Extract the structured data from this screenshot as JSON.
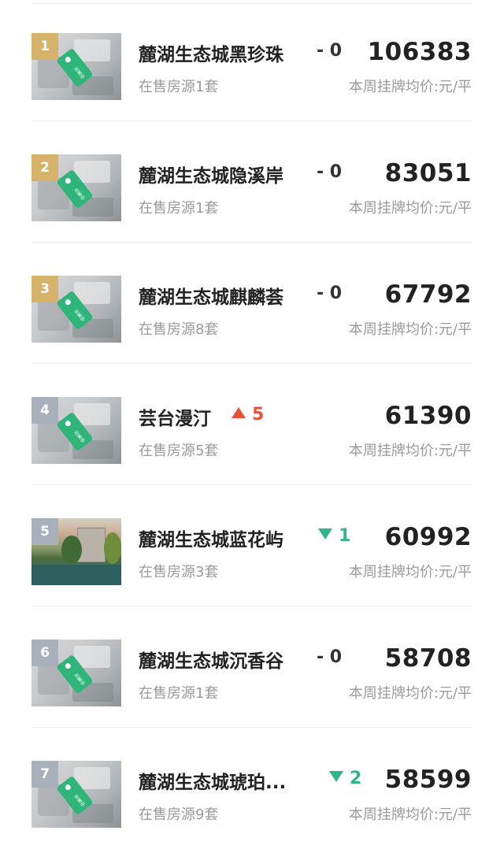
{
  "price_label": "本周挂牌均价:元/平",
  "tag_text": "在售中",
  "rows": [
    {
      "rank": "1",
      "name": "麓湖生态城黑珍珠",
      "change_text": "- 0",
      "direction": "flat",
      "price": "106383",
      "listing": "在售房源1套"
    },
    {
      "rank": "2",
      "name": "麓湖生态城隐溪岸",
      "change_text": "- 0",
      "direction": "flat",
      "price": "83051",
      "listing": "在售房源1套"
    },
    {
      "rank": "3",
      "name": "麓湖生态城麒麟荟",
      "change_text": "- 0",
      "direction": "flat",
      "price": "67792",
      "listing": "在售房源8套"
    },
    {
      "rank": "4",
      "name": "芸台漫汀",
      "change_text": "5",
      "direction": "up",
      "price": "61390",
      "listing": "在售房源5套"
    },
    {
      "rank": "5",
      "name": "麓湖生态城蓝花屿",
      "change_text": "1",
      "direction": "down",
      "price": "60992",
      "listing": "在售房源3套"
    },
    {
      "rank": "6",
      "name": "麓湖生态城沉香谷",
      "change_text": "- 0",
      "direction": "flat",
      "price": "58708",
      "listing": "在售房源1套"
    },
    {
      "rank": "7",
      "name": "麓湖生态城琥珀...",
      "change_text": "2",
      "direction": "down",
      "price": "58599",
      "listing": "在售房源9套"
    }
  ],
  "colors": {
    "gold_badge": "#d6b26a",
    "gray_badge": "#a7b0bb",
    "up": "#e5533c",
    "down": "#2fb58a",
    "tag": "#2fb57a"
  }
}
